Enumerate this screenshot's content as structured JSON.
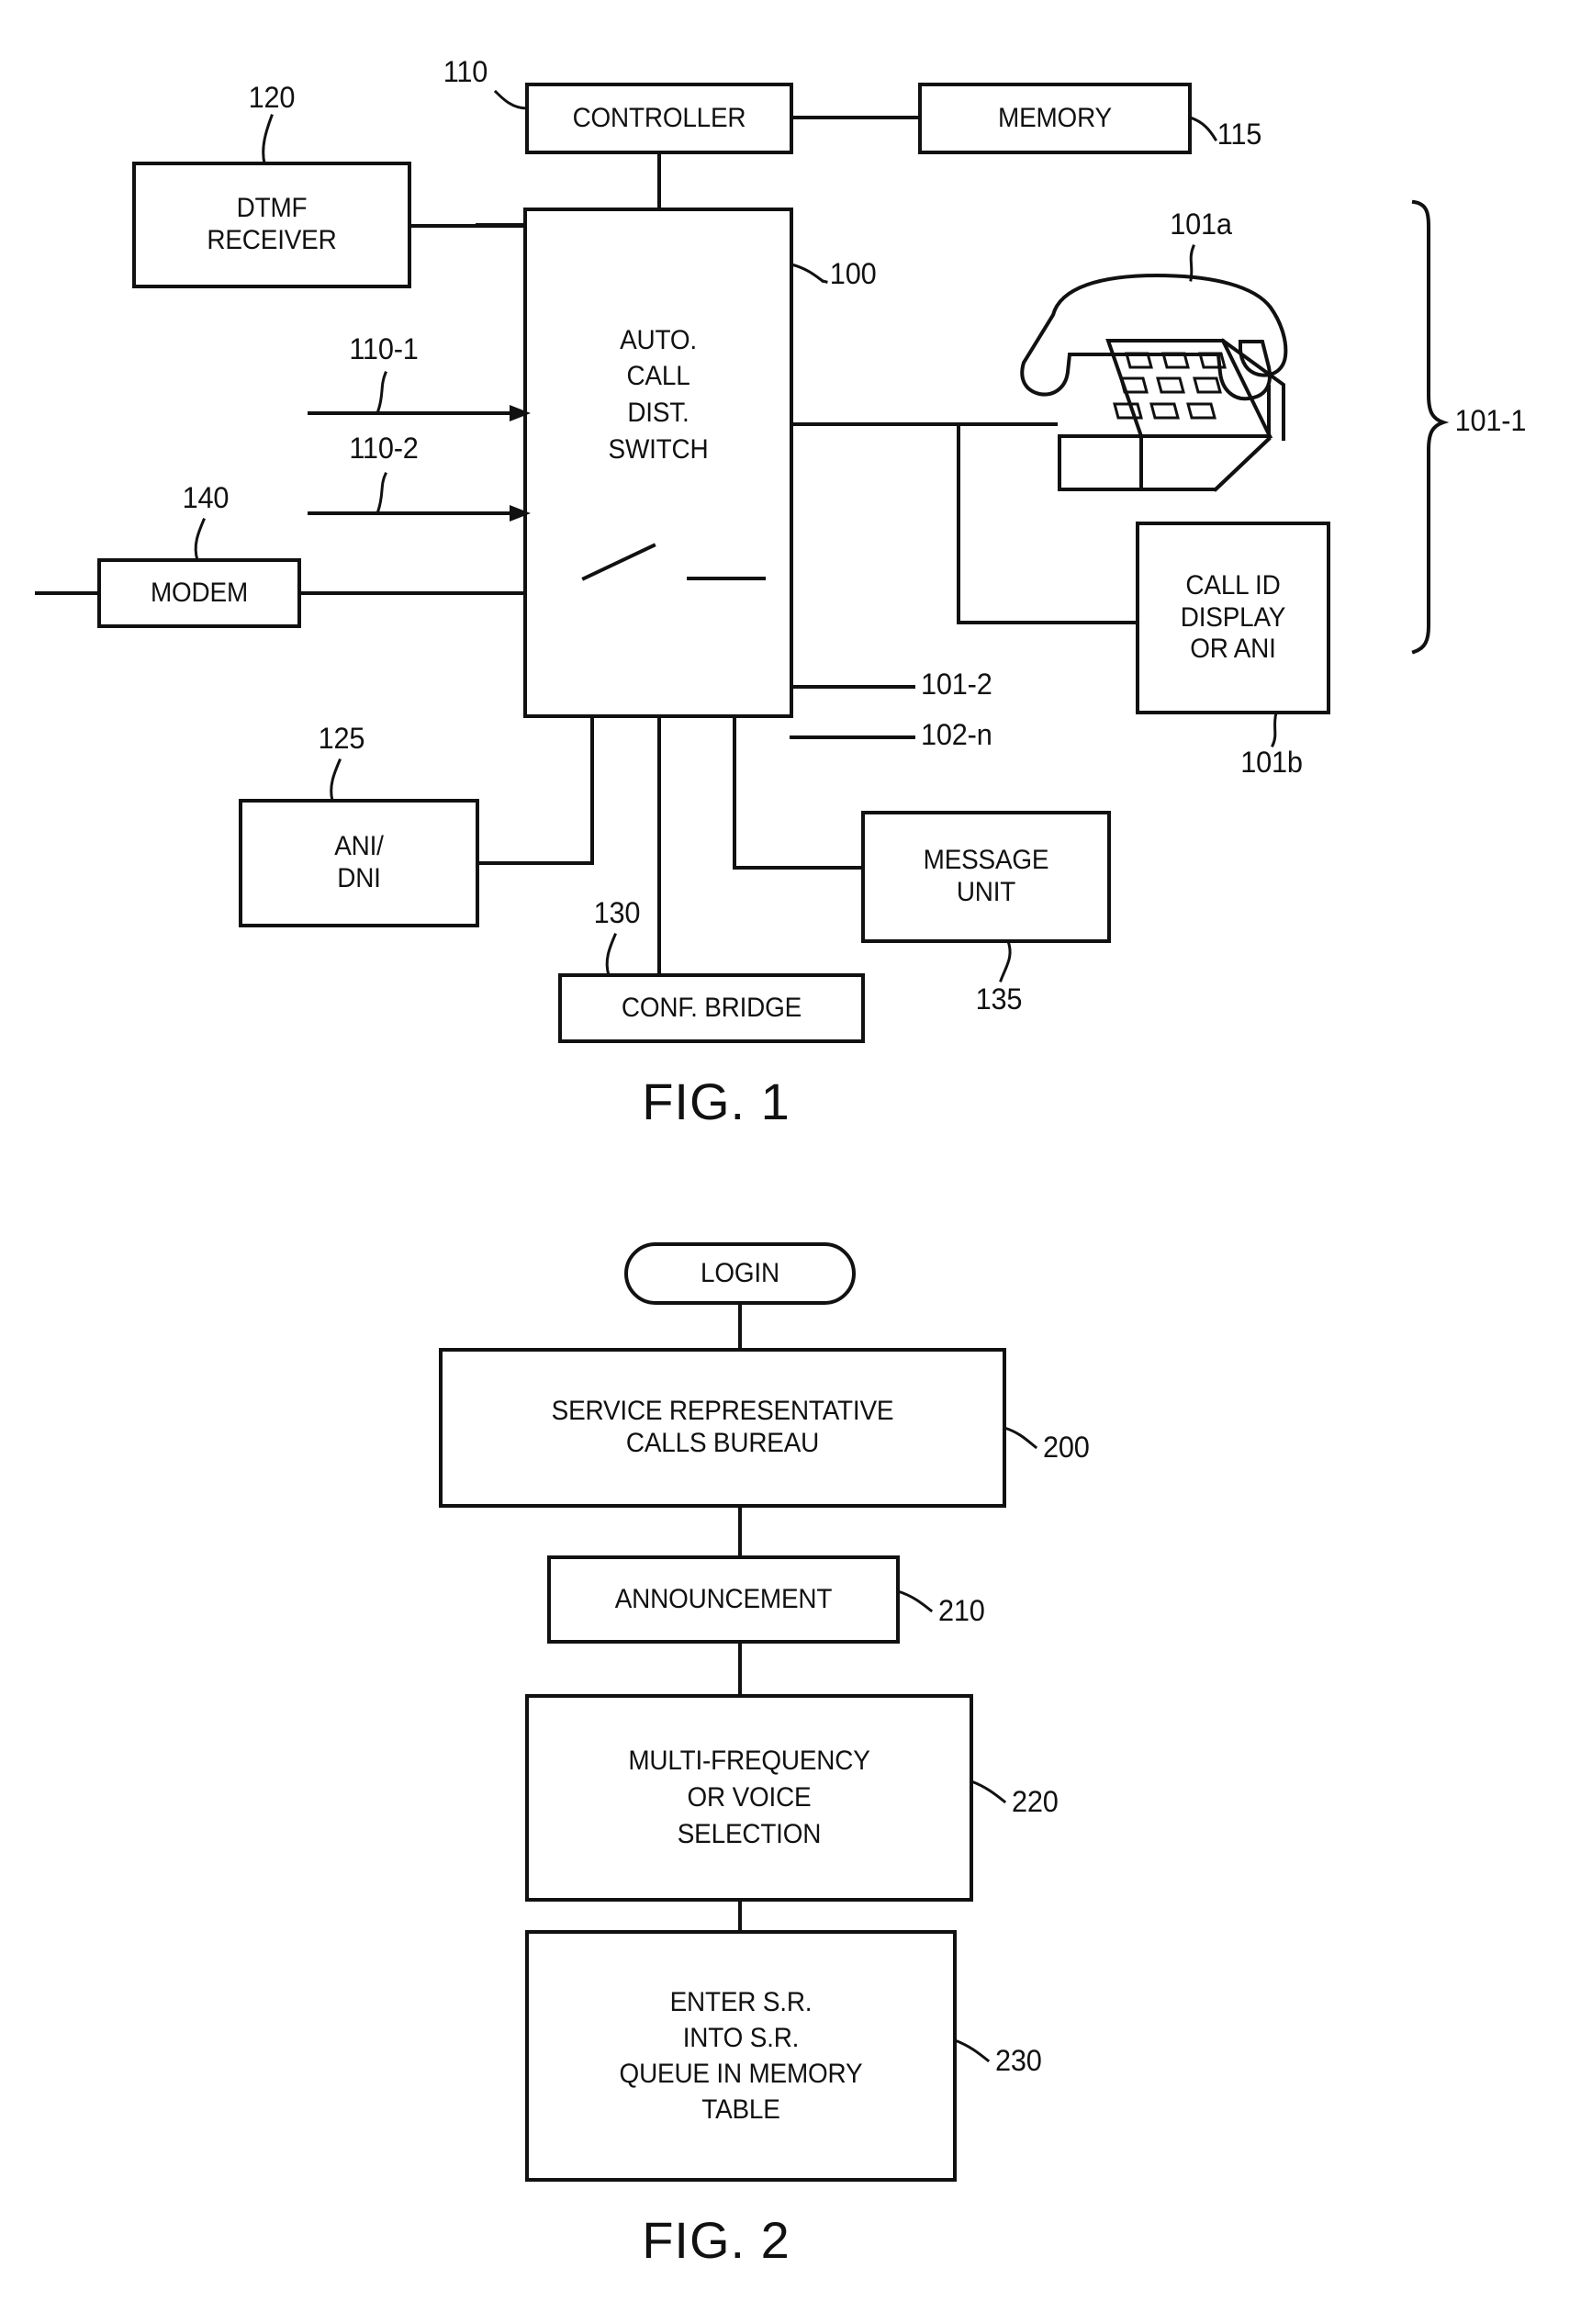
{
  "document": {
    "type": "patent-drawing-sheet",
    "figures": [
      "FIG. 1",
      "FIG. 2"
    ]
  },
  "fig1": {
    "caption": "FIG. 1",
    "blocks": {
      "controller": "CONTROLLER",
      "memory": "MEMORY",
      "dtmf_receiver": "DTMF\nRECEIVER",
      "acd_switch": "AUTO.\nCALL\nDIST.\nSWITCH",
      "modem": "MODEM",
      "ani_dni": "ANI/\nDNI",
      "conf_bridge": "CONF. BRIDGE",
      "message_unit": "MESSAGE\nUNIT",
      "call_id_display": "CALL ID\nDISPLAY\nOR ANI"
    },
    "refs": {
      "controller": "110",
      "memory": "115",
      "dtmf_receiver": "120",
      "acd_switch": "100",
      "trunk_1": "110-1",
      "trunk_2": "110-2",
      "modem": "140",
      "ani_dni": "125",
      "conf_bridge": "130",
      "message_unit": "135",
      "telephone": "101a",
      "call_id_display": "101b",
      "line_101_2": "101-2",
      "line_102_n": "102-n",
      "agent_station": "101-1"
    },
    "icons": {
      "telephone": "desk-telephone-icon",
      "switch_contact": "switch-contact-icon"
    }
  },
  "fig2": {
    "caption": "FIG. 2",
    "terminal": "LOGIN",
    "steps": [
      {
        "label": "SERVICE REPRESENTATIVE\nCALLS BUREAU",
        "ref": "200"
      },
      {
        "label": "ANNOUNCEMENT",
        "ref": "210"
      },
      {
        "label": "MULTI-FREQUENCY\nOR VOICE\nSELECTION",
        "ref": "220"
      },
      {
        "label": "ENTER S.R.\nINTO S.R.\nQUEUE IN MEMORY\nTABLE",
        "ref": "230"
      }
    ]
  },
  "colors": {
    "ink": "#111111",
    "paper": "#ffffff"
  }
}
